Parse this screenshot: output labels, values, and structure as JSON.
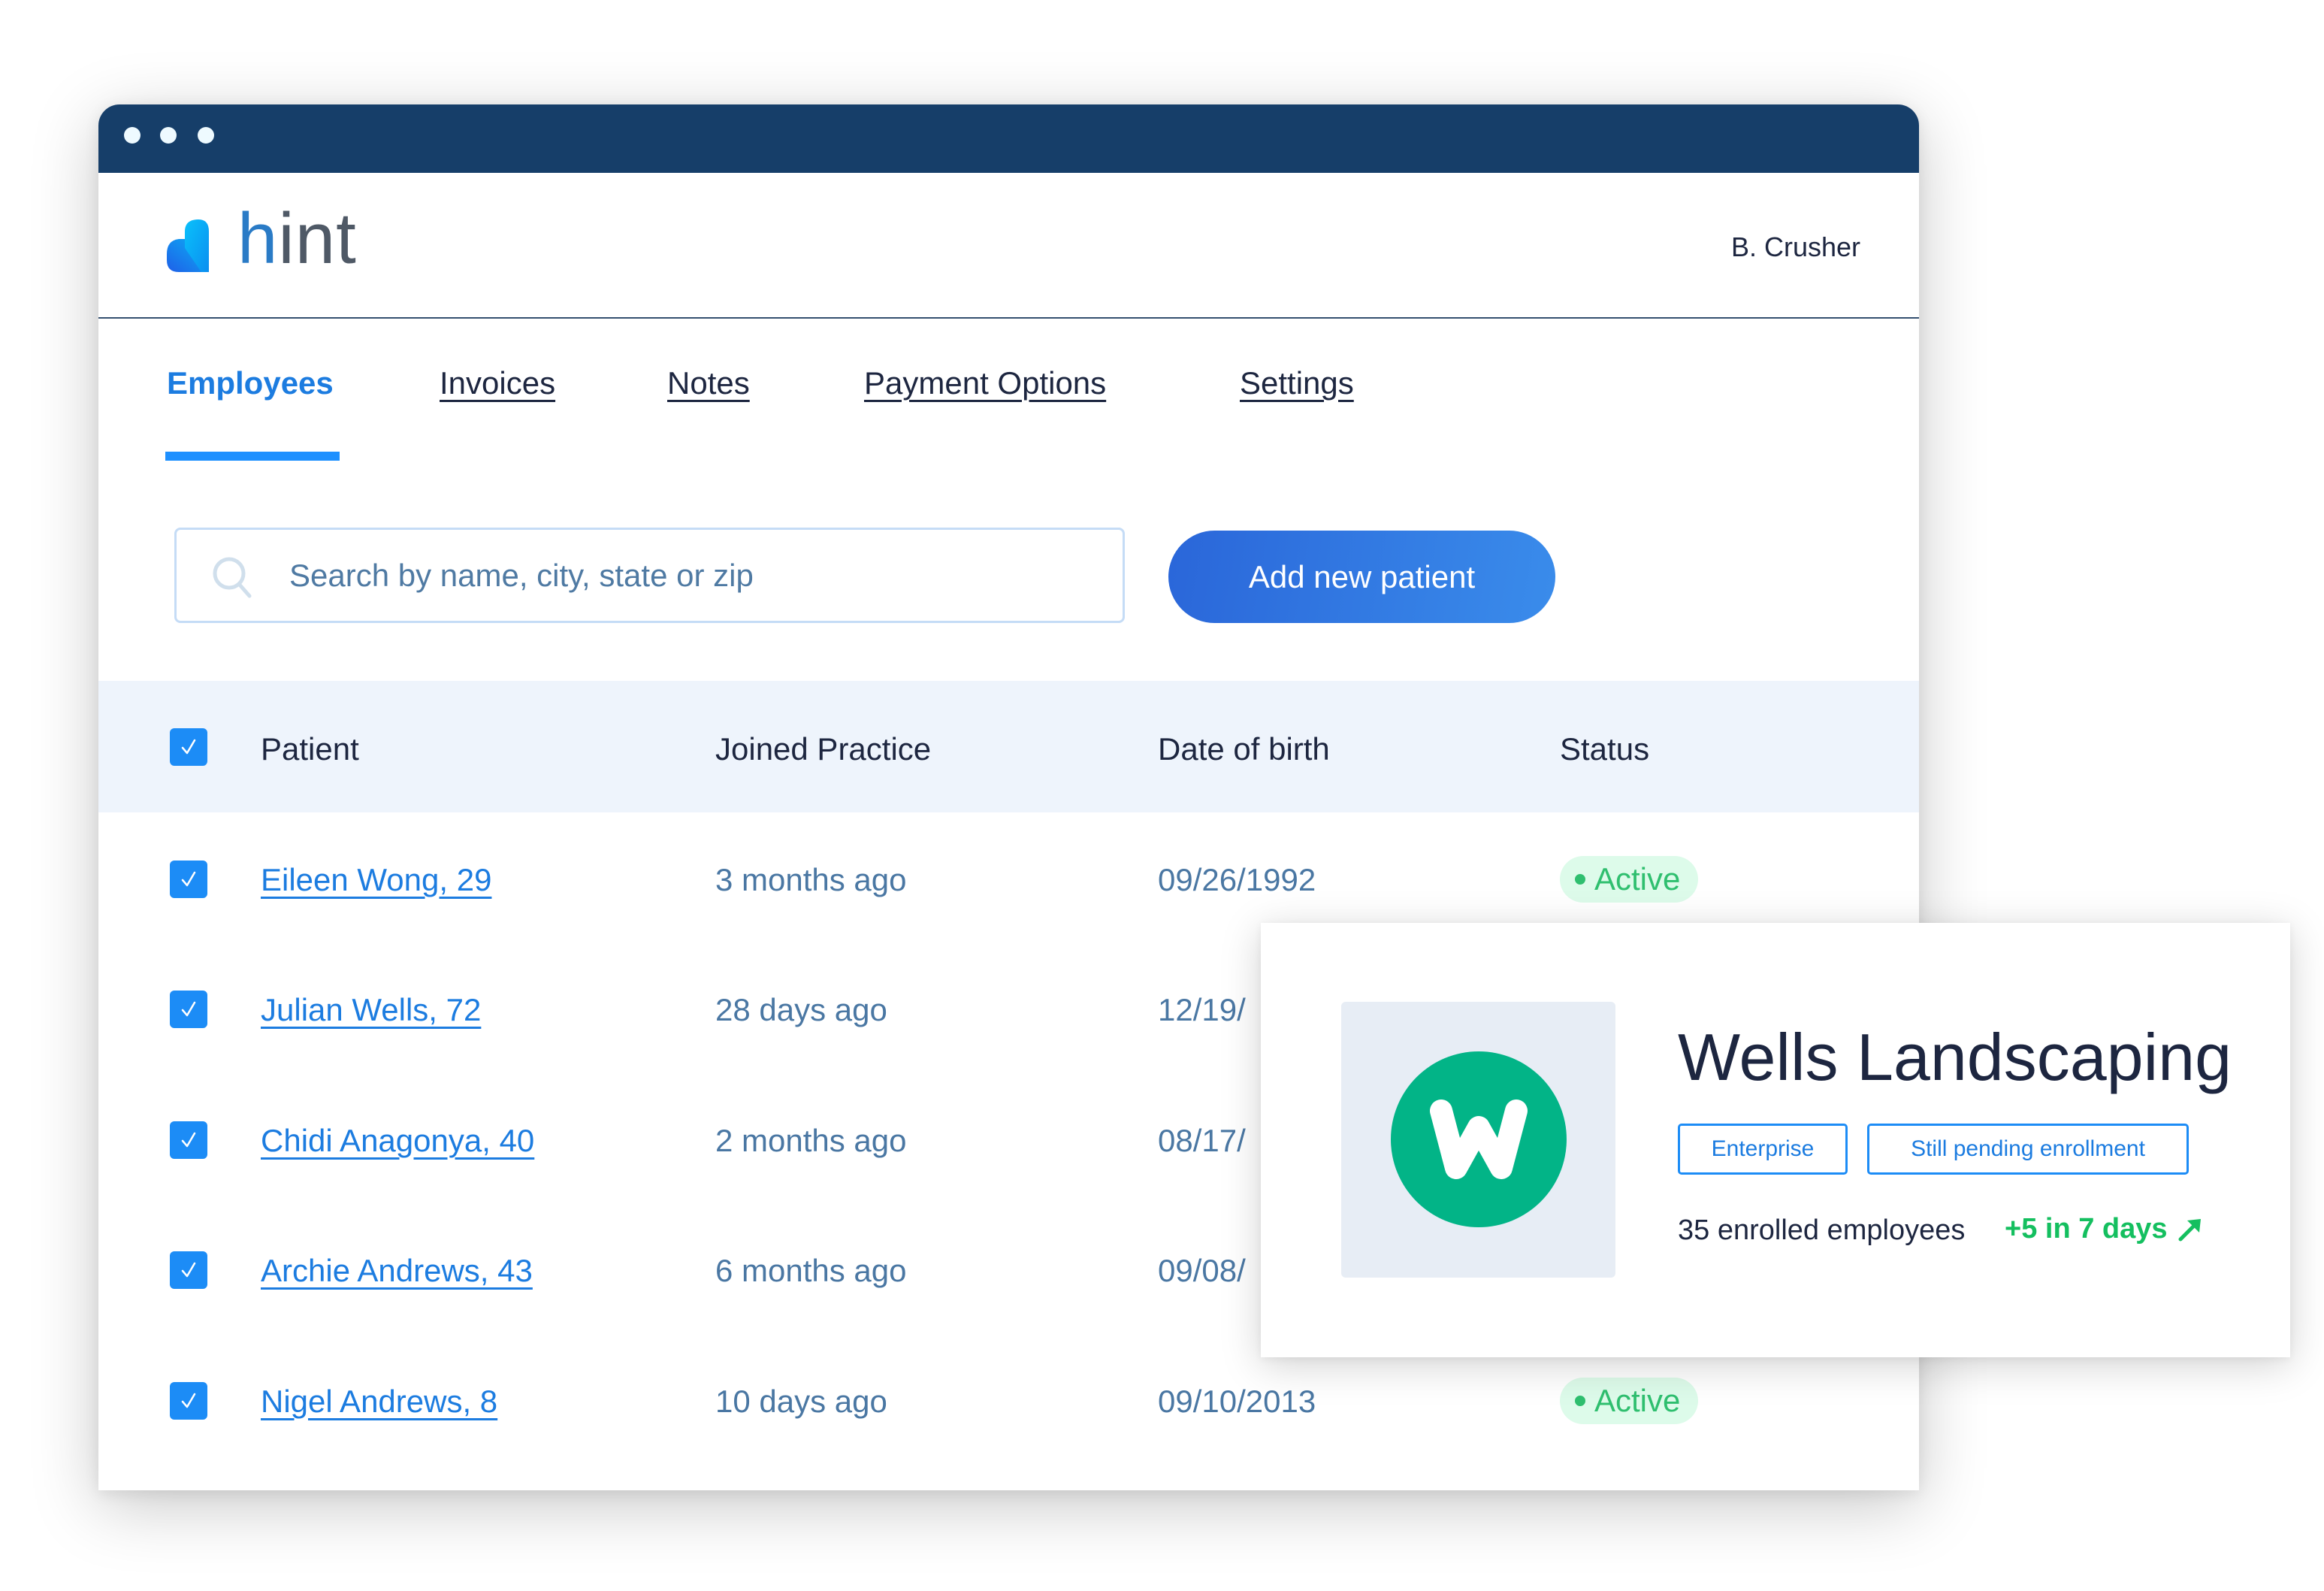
{
  "app": {
    "name": "hint",
    "window_controls": [
      "dot",
      "dot",
      "dot"
    ]
  },
  "header": {
    "logo_text_first": "h",
    "logo_text_rest": "int",
    "user_name": "B. Crusher"
  },
  "tabs": [
    {
      "label": "Employees",
      "active": true
    },
    {
      "label": "Invoices",
      "active": false
    },
    {
      "label": "Notes",
      "active": false
    },
    {
      "label": "Payment Options",
      "active": false
    },
    {
      "label": "Settings",
      "active": false
    }
  ],
  "search": {
    "placeholder": "Search by name, city, state or zip",
    "value": "",
    "icon": "search-icon"
  },
  "actions": {
    "add_patient_label": "Add new patient"
  },
  "table": {
    "select_all_checked": true,
    "columns": [
      "Patient",
      "Joined Practice",
      "Date of birth",
      "Status"
    ],
    "rows": [
      {
        "checked": true,
        "patient": "Eileen Wong, 29",
        "joined": "3 months ago",
        "dob": "09/26/1992",
        "status": "Active"
      },
      {
        "checked": true,
        "patient": "Julian Wells, 72",
        "joined": "28 days ago",
        "dob": "12/19/",
        "status": null
      },
      {
        "checked": true,
        "patient": "Chidi Anagonya, 40",
        "joined": "2 months ago",
        "dob": "08/17/",
        "status": null
      },
      {
        "checked": true,
        "patient": "Archie Andrews, 43",
        "joined": "6 months ago",
        "dob": "09/08/",
        "status": null
      },
      {
        "checked": true,
        "patient": "Nigel Andrews, 8",
        "joined": "10 days ago",
        "dob": "09/10/2013",
        "status": "Active"
      }
    ]
  },
  "company_card": {
    "logo_letter": "W",
    "name": "Wells Landscaping",
    "badges": [
      "Enterprise",
      "Still pending enrollment"
    ],
    "enrolled_text": "35 enrolled employees",
    "growth_text": "+5 in 7 days",
    "growth_icon": "arrow-up-right-icon"
  },
  "colors": {
    "titlebar": "#163e69",
    "accent": "#1c7ce0",
    "button_gradient_start": "#2a66d9",
    "button_gradient_end": "#3a8ceb",
    "status_active_text": "#2fbf6f",
    "status_active_bg": "#ddfbea",
    "company_logo": "#02b487",
    "growth": "#14bf5f"
  }
}
